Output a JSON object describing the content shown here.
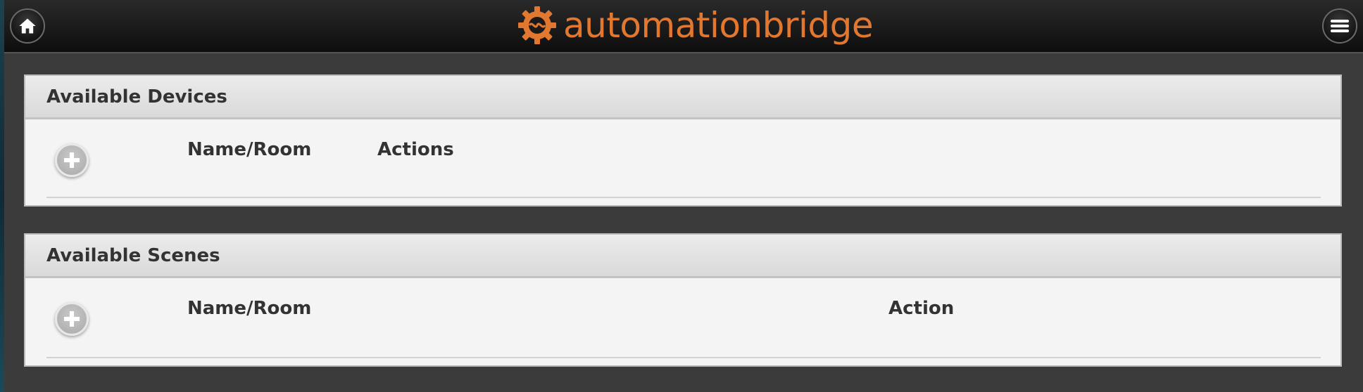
{
  "header": {
    "logo_text_1": "automation",
    "logo_text_2": "bridge",
    "brand_color": "#e2782f",
    "home_icon": "home-icon",
    "menu_icon": "hamburger-menu-icon"
  },
  "devices": {
    "title": "Available Devices",
    "col_name": "Name/Room",
    "col_actions": "Actions",
    "add_icon": "plus-icon"
  },
  "scenes": {
    "title": "Available Scenes",
    "col_name": "Name/Room",
    "col_action": "Action",
    "add_icon": "plus-icon"
  }
}
